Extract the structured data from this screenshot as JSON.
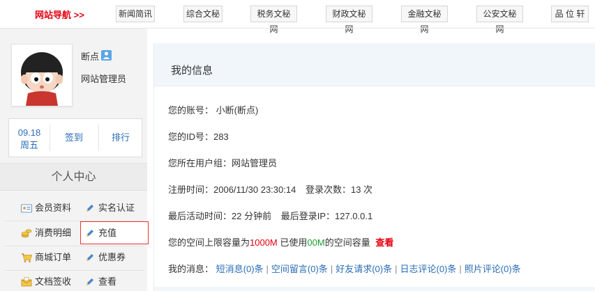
{
  "topnav": {
    "brand": "网站导航 >>",
    "links": [
      "新闻简讯",
      "综合文秘",
      "税务文秘网",
      "财政文秘网",
      "金融文秘网",
      "公安文秘网",
      "品 位 轩"
    ]
  },
  "profile": {
    "username": "断点",
    "role": "网站管理员"
  },
  "datebox": {
    "date": "09.18",
    "weekday": "周五",
    "signin": "签到",
    "rank": "排行"
  },
  "personal_center": {
    "title": "个人中心",
    "menu": [
      {
        "label": "会员资料",
        "icon": "id-card-icon"
      },
      {
        "label": "实名认证",
        "icon": "pencil-icon"
      },
      {
        "label": "消费明细",
        "icon": "coins-icon"
      },
      {
        "label": "充值",
        "icon": "pencil-icon"
      },
      {
        "label": "商城订单",
        "icon": "cart-icon"
      },
      {
        "label": "优惠券",
        "icon": "pencil-icon"
      },
      {
        "label": "文档签收",
        "icon": "inbox-icon"
      },
      {
        "label": "查看",
        "icon": "pencil-icon"
      }
    ]
  },
  "my_info": {
    "title": "我的信息",
    "account_label": "您的账号：",
    "account_value": "小断(断点)",
    "id_label": "您的ID号：",
    "id_value": "283",
    "group_label": "您所在用户组：",
    "group_value": "网站管理员",
    "reg_label": "注册时间：",
    "reg_value": "2006/11/30 23:30:14",
    "login_count_label": "登录次数：",
    "login_count_value": "13 次",
    "last_active_label": "最后活动时间：",
    "last_active_value": "22 分钟前",
    "last_ip_label": "最后登录IP：",
    "last_ip_value": "127.0.0.1",
    "space_prefix": "您的空间上限容量为",
    "space_limit": "1000M",
    "space_mid": " 已使用",
    "space_used": "00M",
    "space_suffix": "的空间容量",
    "space_view": "查看",
    "messages_label": "我的消息：",
    "messages": [
      "短消息(0)条",
      "空间留言(0)条",
      "好友请求(0)条",
      "日志评论(0)条",
      "照片评论(0)条"
    ]
  },
  "colors": {
    "brand_red": "#e60012",
    "link_blue": "#2a6db6",
    "used_green": "#1a9b32",
    "panel_header_bg": "#f1f6fb"
  }
}
